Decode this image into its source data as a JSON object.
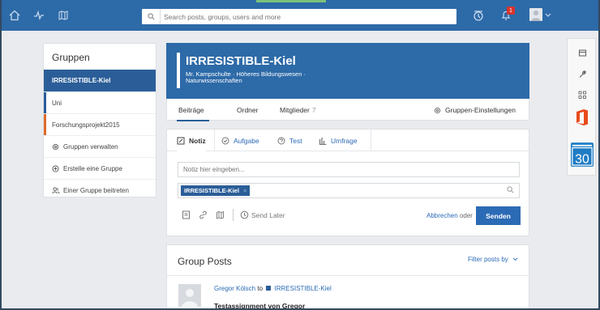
{
  "topbar": {
    "search_placeholder": "Search posts, groups, users and more",
    "notification_count": "1",
    "icons": [
      "home-icon",
      "activity-icon",
      "backpack-icon",
      "search-icon",
      "planner-icon",
      "bell-icon",
      "avatar-icon",
      "chevron-down-icon"
    ],
    "colors": {
      "bar": "#2d6aa8",
      "progress": "#7cc27a"
    }
  },
  "sidebar": {
    "title": "Gruppen",
    "groups": [
      {
        "label": "IRRESISTIBLE-Kiel",
        "active": true
      },
      {
        "label": "Uni"
      },
      {
        "label": "Forschungsprojekt2015",
        "color": "#e06a2b"
      }
    ],
    "actions": [
      {
        "label": "Gruppen verwalten",
        "icon": "gear-icon"
      },
      {
        "label": "Erstelle eine Gruppe",
        "icon": "plus-circle-icon"
      },
      {
        "label": "Einer Gruppe beitreten",
        "icon": "users-icon"
      }
    ]
  },
  "group": {
    "name": "IRRESISTIBLE-Kiel",
    "subtitle": "Mr. Kampschulte · Höheres Bildungswesen · Naturwissenschaften",
    "tabs": [
      {
        "label": "Beiträge"
      },
      {
        "label": "Ordner"
      },
      {
        "label": "Mitglieder",
        "count": "7"
      }
    ],
    "settings_label": "Gruppen-Einstellungen"
  },
  "composer": {
    "tabs": [
      {
        "label": "Notiz",
        "icon": "note-icon"
      },
      {
        "label": "Aufgabe",
        "icon": "check-circle-icon"
      },
      {
        "label": "Test",
        "icon": "quiz-icon"
      },
      {
        "label": "Umfrage",
        "icon": "bar-chart-icon"
      }
    ],
    "note_placeholder": "Notiz hier eingeben...",
    "recipient_tag": "IRRESISTIBLE-Kiel",
    "tag_remove": "×",
    "send_later": "Send Later",
    "cancel_label": "Abbrechen",
    "or_label": "oder",
    "send_label": "Senden"
  },
  "posts": {
    "title": "Group Posts",
    "filter_label": "Filter posts by",
    "first_post": {
      "author": "Gregor Kölsch",
      "to_label": "to",
      "group": "IRRESISTIBLE-Kiel",
      "title": "Testassignment von Gregor"
    }
  },
  "right_rail": {
    "items": [
      "store-icon",
      "wrench-icon",
      "apps-grid-icon",
      "office-icon",
      "calendar-30-icon"
    ],
    "calendar_day": "30"
  }
}
